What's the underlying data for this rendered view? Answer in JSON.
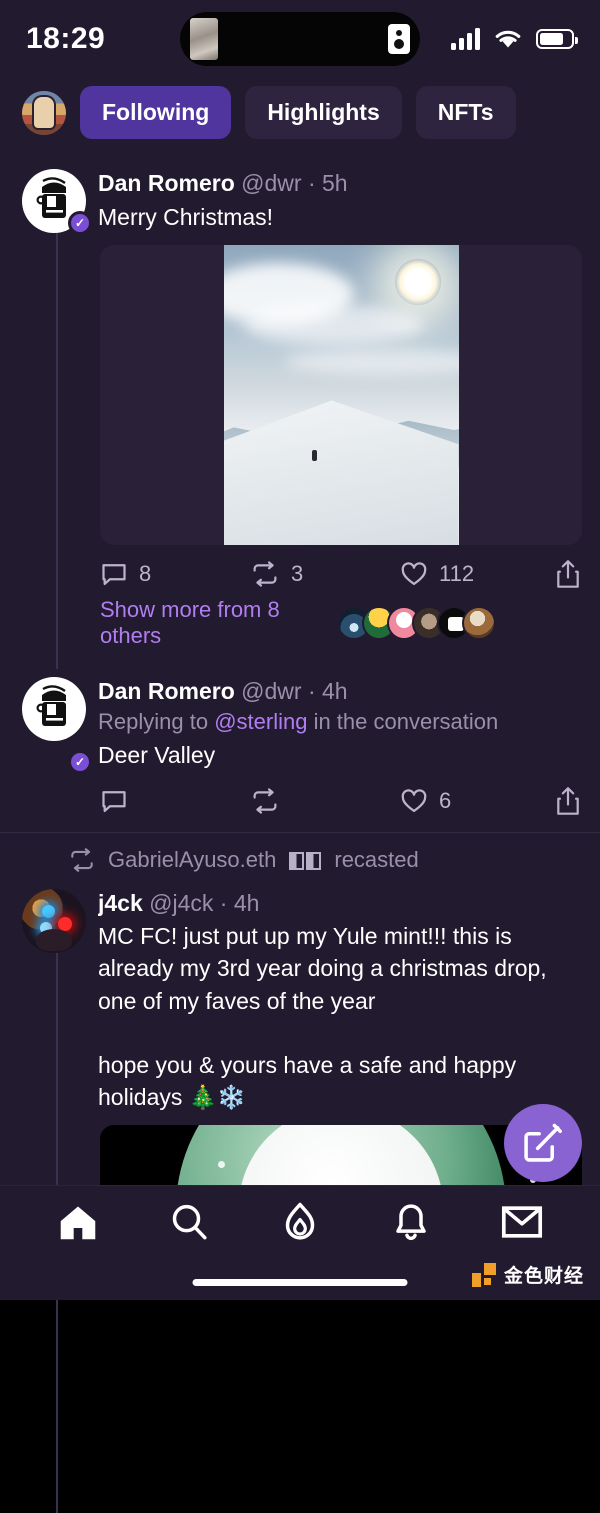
{
  "status_bar": {
    "time": "18:29",
    "signal_icon": "cellular-bars-icon",
    "wifi_icon": "wifi-icon",
    "battery_icon": "battery-icon"
  },
  "header": {
    "avatar_name": "user-avatar",
    "tabs": [
      {
        "label": "Following",
        "active": true
      },
      {
        "label": "Highlights",
        "active": false
      },
      {
        "label": "NFTs",
        "active": false
      }
    ]
  },
  "posts": [
    {
      "display_name": "Dan Romero",
      "handle": "@dwr",
      "separator": "·",
      "time": "5h",
      "verified": true,
      "text": "Merry Christmas!",
      "media": "ski-slope-photo",
      "actions": {
        "comment_count": "8",
        "recast_count": "3",
        "like_count": "112",
        "share_label": ""
      },
      "show_more": "Show more from 8 others"
    },
    {
      "display_name": "Dan Romero",
      "handle": "@dwr",
      "separator": "·",
      "time": "4h",
      "verified": true,
      "replying_prefix": "Replying to ",
      "replying_mention": "@sterling",
      "replying_suffix": " in the conversation",
      "text": "Deer Valley",
      "actions": {
        "comment_count": "",
        "recast_count": "",
        "like_count": "6",
        "share_label": ""
      }
    },
    {
      "recast_by": "GabrielAyuso.eth",
      "recast_suffix": "recasted",
      "display_name": "j4ck",
      "handle": "@j4ck",
      "separator": "·",
      "time": "4h",
      "verified": false,
      "text": "MC FC! just put up my Yule mint!!! this is already my 3rd year doing a christmas drop, one of my faves of the year\n\nhope you & yours have a safe and happy holidays 🎄❄️",
      "media": "snowball-image"
    }
  ],
  "compose": {
    "icon": "compose-pencil-icon"
  },
  "bottom_nav": [
    {
      "icon": "home-icon",
      "active": true
    },
    {
      "icon": "search-icon",
      "active": false
    },
    {
      "icon": "flame-icon",
      "active": false
    },
    {
      "icon": "bell-icon",
      "active": false
    },
    {
      "icon": "envelope-icon",
      "active": false
    }
  ],
  "watermark": {
    "text": "金色财经"
  },
  "colors": {
    "background": "#221a2e",
    "accent_purple": "#8a63d2",
    "active_tab": "#50359e",
    "link": "#b07ef0",
    "muted_text": "#9a90ab"
  }
}
